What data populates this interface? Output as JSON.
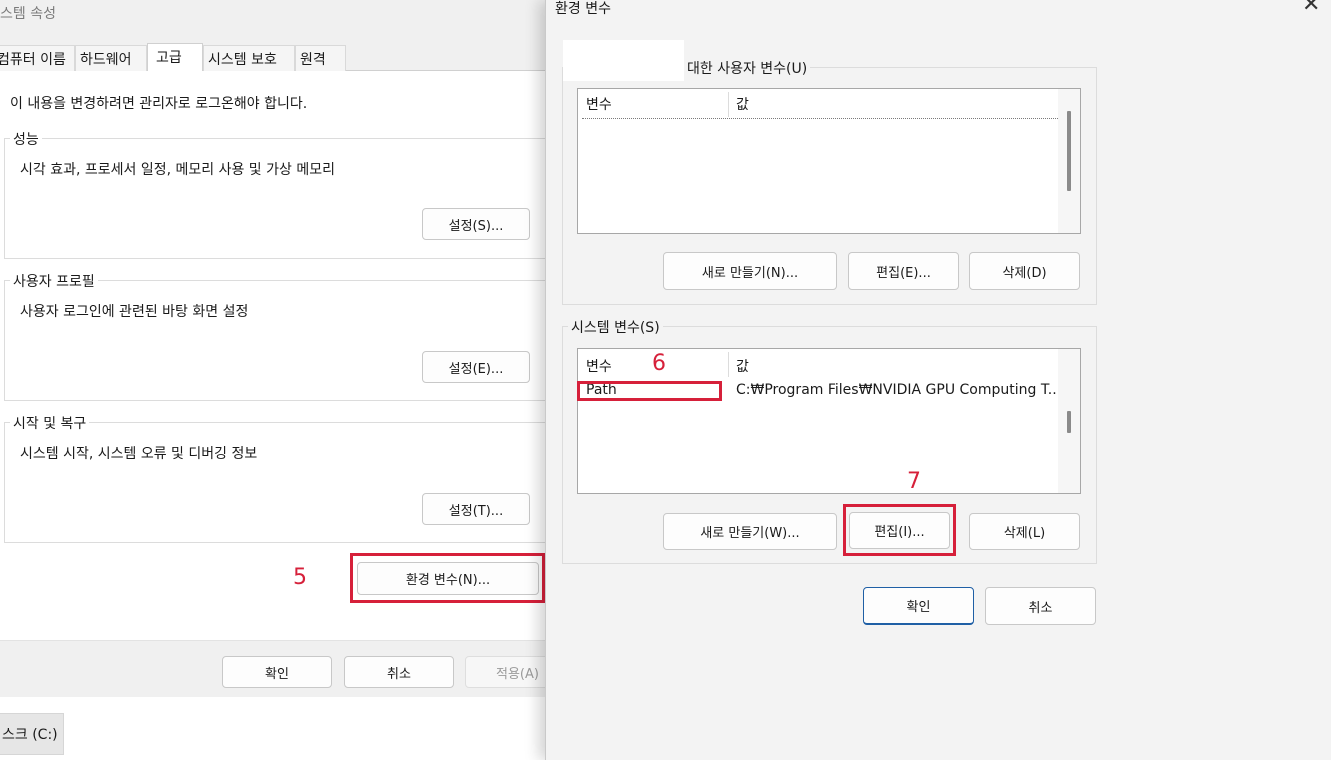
{
  "system_properties": {
    "title": "스템 속성",
    "tabs": [
      "컴퓨터 이름",
      "하드웨어",
      "고급",
      "시스템 보호",
      "원격"
    ],
    "admin_note": "이 내용을 변경하려면 관리자로 로그온해야 합니다.",
    "performance": {
      "title": "성능",
      "desc": "시각 효과, 프로세서 일정, 메모리 사용 및 가상 메모리",
      "button": "설정(S)..."
    },
    "user_profiles": {
      "title": "사용자 프로필",
      "desc": "사용자 로그인에 관련된 바탕 화면 설정",
      "button": "설정(E)..."
    },
    "startup_recovery": {
      "title": "시작 및 복구",
      "desc": "시스템 시작, 시스템 오류 및 디버깅 정보",
      "button": "설정(T)..."
    },
    "env_button": "환경 변수(N)...",
    "ok": "확인",
    "cancel": "취소",
    "apply": "적용(A)",
    "taskbar_drive": "스크 (C:)"
  },
  "env_vars": {
    "title": "환경 변수",
    "close_glyph": "✕",
    "user_group": {
      "title": "대한 사용자 변수(U)",
      "col_var": "변수",
      "col_val": "값",
      "new": "새로 만들기(N)...",
      "edit": "편집(E)...",
      "delete": "삭제(D)"
    },
    "system_group": {
      "title": "시스템 변수(S)",
      "col_var": "변수",
      "col_val": "값",
      "rows": [
        {
          "name": "Path",
          "value": "C:₩Program Files₩NVIDIA GPU Computing T..."
        }
      ],
      "new": "새로 만들기(W)...",
      "edit": "편집(I)...",
      "delete": "삭제(L)"
    },
    "ok": "확인",
    "cancel": "취소"
  },
  "annotations": {
    "step5": "5",
    "step6": "6",
    "step7": "7",
    "color": "#d6203a"
  }
}
